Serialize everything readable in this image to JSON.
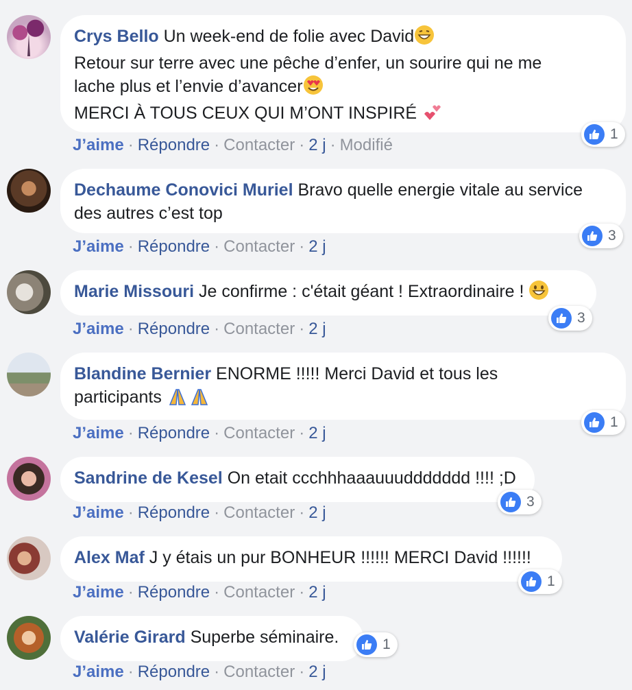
{
  "comments": [
    {
      "name": "Crys Bello",
      "lines": [
        "Un week-end de folie avec David",
        "Retour sur terre avec une pêche d’enfer, un sourire qui ne me",
        "lache plus et l’envie d’avancer",
        "MERCI À TOUS CEUX QUI M’ONT INSPIRÉ "
      ],
      "likes": "1",
      "actions": {
        "like": "J’aime",
        "reply": "Répondre",
        "contact": "Contacter",
        "time": "2 j",
        "extra": "Modifié"
      }
    },
    {
      "name": "Dechaume Conovici Muriel",
      "lines": [
        "Bravo quelle energie vitale au service",
        "des autres c’est top"
      ],
      "likes": "3",
      "actions": {
        "like": "J’aime",
        "reply": "Répondre",
        "contact": "Contacter",
        "time": "2 j"
      }
    },
    {
      "name": "Marie Missouri",
      "lines": [
        "Je confirme : c'était géant ! Extraordinaire ! "
      ],
      "likes": "3",
      "actions": {
        "like": "J’aime",
        "reply": "Répondre",
        "contact": "Contacter",
        "time": "2 j"
      }
    },
    {
      "name": "Blandine Bernier",
      "lines": [
        "ENORME !!!!! Merci David et tous les",
        "participants "
      ],
      "likes": "1",
      "actions": {
        "like": "J’aime",
        "reply": "Répondre",
        "contact": "Contacter",
        "time": "2 j"
      }
    },
    {
      "name": "Sandrine de Kesel",
      "lines": [
        "On etait ccchhhaaauuuddddddd !!!! ;D"
      ],
      "likes": "3",
      "actions": {
        "like": "J’aime",
        "reply": "Répondre",
        "contact": "Contacter",
        "time": "2 j"
      }
    },
    {
      "name": "Alex Maf",
      "lines": [
        "J y étais un pur BONHEUR !!!!!! MERCI David !!!!!!"
      ],
      "likes": "1",
      "actions": {
        "like": "J’aime",
        "reply": "Répondre",
        "contact": "Contacter",
        "time": "2 j"
      }
    },
    {
      "name": "Valérie Girard",
      "lines": [
        "Superbe séminaire."
      ],
      "likes": "1",
      "actions": {
        "like": "J’aime",
        "reply": "Répondre",
        "contact": "Contacter",
        "time": "2 j"
      }
    }
  ],
  "icons": {
    "reaction": "like-thumb-icon"
  },
  "colors": {
    "name": "#385898",
    "like": "#4b6fc1",
    "reaction": "#3b7df5",
    "bubble": "#ffffff",
    "background": "#f2f3f5"
  }
}
